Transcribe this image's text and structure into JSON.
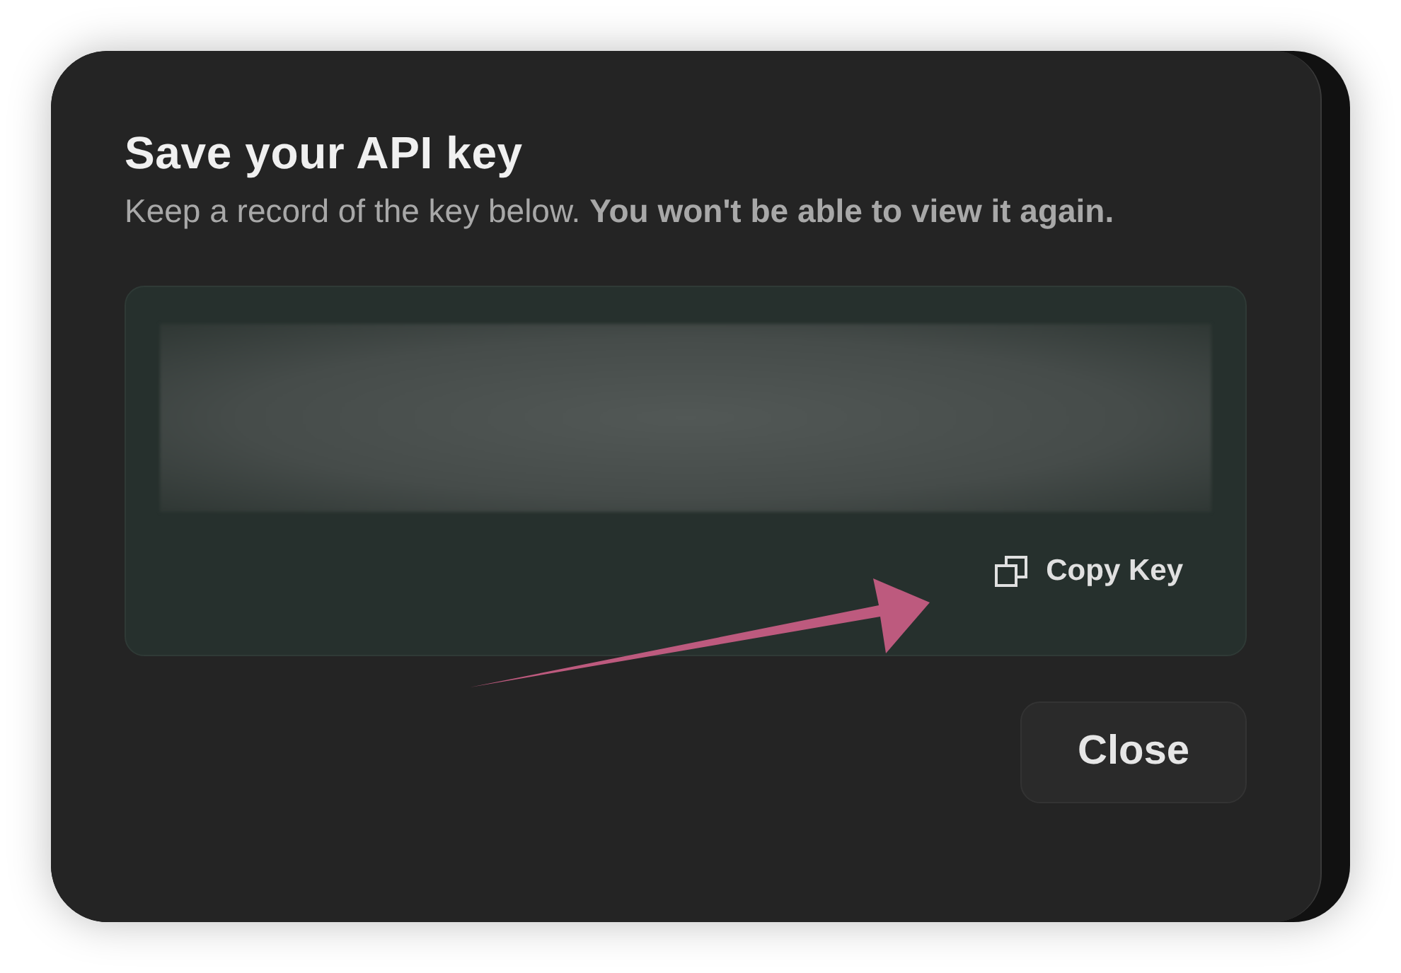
{
  "dialog": {
    "title": "Save your API key",
    "description": "Keep a record of the key below. **You won't be able to view it again.**",
    "copy_button": {
      "label": "Copy Key"
    },
    "close_button": {
      "label": "Close"
    }
  }
}
